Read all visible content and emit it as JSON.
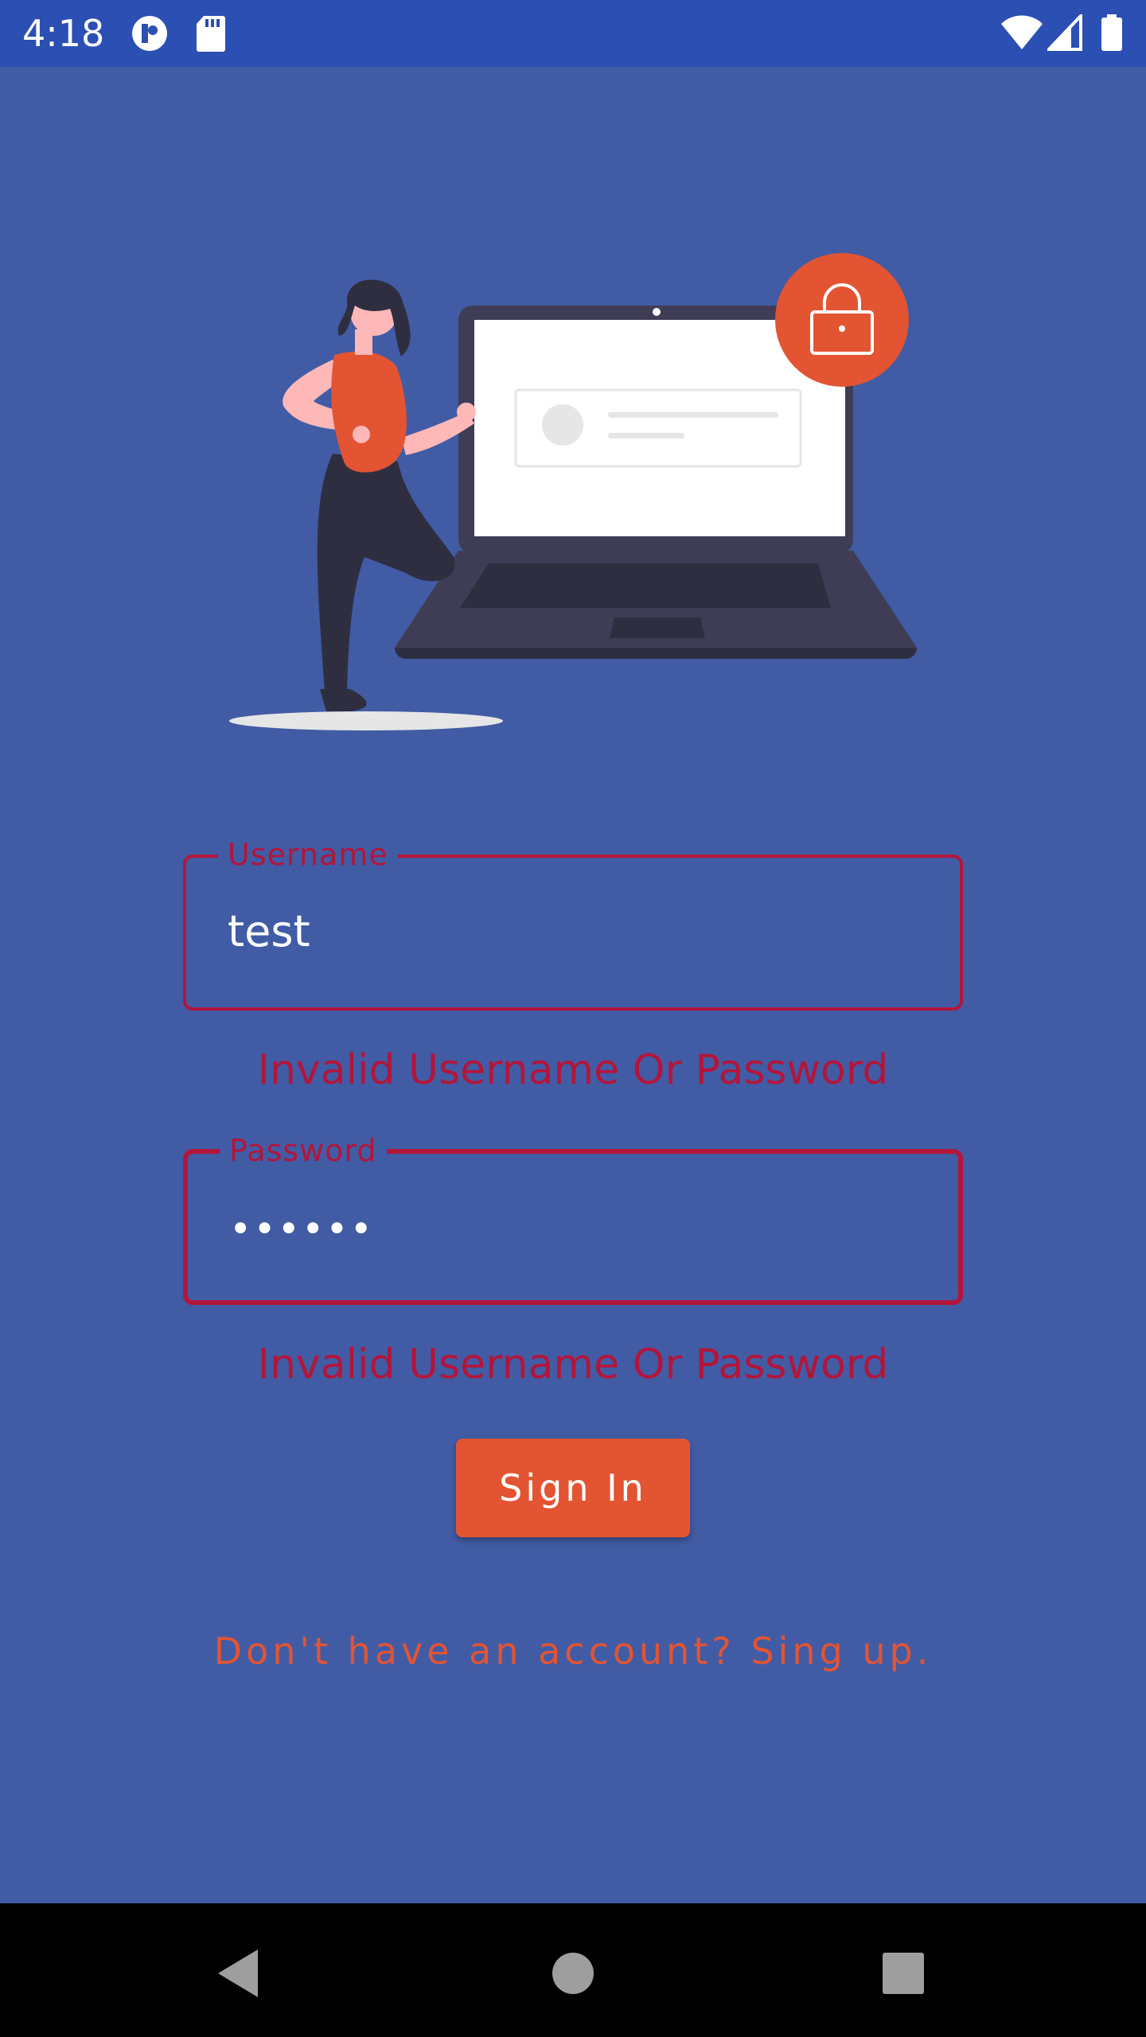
{
  "status_bar": {
    "time": "4:18",
    "left_icons": [
      "app-notification-icon",
      "sd-card-icon"
    ],
    "right_icons": [
      "wifi-icon",
      "cell-signal-icon",
      "battery-icon"
    ]
  },
  "illustration": {
    "description_icon": "login-illustration",
    "colors": {
      "accent": "#e35433",
      "laptop": "#3f3d56",
      "screen": "#ffffff"
    }
  },
  "form": {
    "username": {
      "label": "Username",
      "value": "test",
      "error": "Invalid Username Or Password"
    },
    "password": {
      "label": "Password",
      "value": "••••••",
      "error": "Invalid Username Or Password"
    },
    "signin_label": "Sign In",
    "signup_text": "Don't have an account? Sing up."
  },
  "nav_bar": {
    "icons": [
      "back-icon",
      "home-icon",
      "recents-icon"
    ]
  },
  "colors": {
    "background": "#415ca5",
    "status_bar": "#2b4fb3",
    "error": "#b3153a",
    "accent": "#e35433"
  }
}
